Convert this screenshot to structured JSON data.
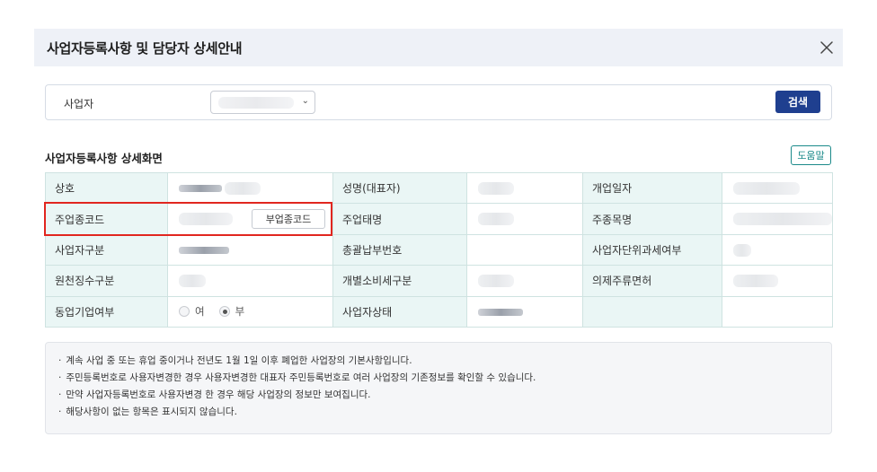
{
  "modal": {
    "title": "사업자등록사항 및 담당자 상세안내"
  },
  "search": {
    "label": "사업자",
    "button_label": "검색"
  },
  "detail": {
    "title": "사업자등록사항 상세화면",
    "help_label": "도움말",
    "labels": {
      "company_name": "상호",
      "name_rep": "성명(대표자)",
      "open_date": "개업일자",
      "main_code": "주업종코드",
      "main_type": "주업태명",
      "main_item": "주종목명",
      "biz_class": "사업자구분",
      "total_pay_no": "총괄납부번호",
      "unit_tax": "사업자단위과세여부",
      "withholding": "원천징수구분",
      "consumption_tax": "개별소비세구분",
      "liquor_license": "의제주류면허",
      "same_biz": "동업기업여부",
      "biz_status": "사업자상태"
    },
    "sub_code_button": "부업종코드",
    "radio": {
      "yes": "여",
      "no": "부",
      "selected": "부"
    }
  },
  "notice": {
    "items": [
      "계속 사업 중 또는 휴업 중이거나 전년도 1월 1일 이후 폐업한 사업장의 기본사항입니다.",
      "주민등록번호로 사용자변경한 경우 사용자변경한 대표자 주민등록번호로 여러 사업장의 기존정보를 확인할 수 있습니다.",
      "만약 사업자등록번호로 사용자변경 한 경우 해당 사업장의 정보만 보여집니다.",
      "해당사항이 없는 항목은 표시되지 않습니다."
    ]
  },
  "colors": {
    "header_bg": "#eef1f7",
    "primary": "#1f3f8f",
    "teal": "#1b8a8a",
    "label_bg": "#eaf6f5",
    "highlight": "#e1261f"
  }
}
